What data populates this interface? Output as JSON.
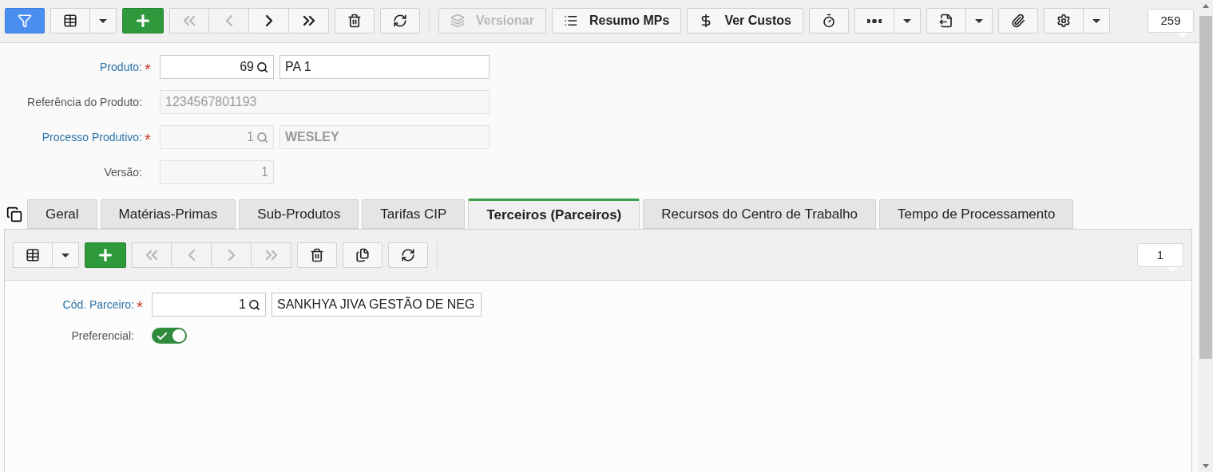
{
  "toolbar": {
    "items": [
      {
        "kind": "filter",
        "disabled": false
      },
      {
        "kind": "grid-menu",
        "disabled": false
      },
      {
        "kind": "add",
        "disabled": false
      },
      {
        "kind": "first",
        "disabled": true
      },
      {
        "kind": "prev",
        "disabled": true
      },
      {
        "kind": "next",
        "disabled": false
      },
      {
        "kind": "last",
        "disabled": false
      },
      {
        "kind": "delete",
        "disabled": false
      },
      {
        "kind": "refresh",
        "disabled": false
      },
      {
        "kind": "separator"
      },
      {
        "kind": "versions",
        "label": "Versionar",
        "disabled": true
      },
      {
        "kind": "list",
        "label": "Resumo MPs",
        "disabled": false
      },
      {
        "kind": "money",
        "label": "Ver Custos",
        "disabled": false
      },
      {
        "kind": "timer",
        "disabled": false
      },
      {
        "kind": "more-menu",
        "disabled": false
      },
      {
        "kind": "export-menu",
        "disabled": false
      },
      {
        "kind": "attach",
        "disabled": false
      },
      {
        "kind": "settings-menu",
        "disabled": false
      }
    ],
    "record_count": "259"
  },
  "form": [
    {
      "label": "Produto:",
      "required_mark": "*",
      "code": "69",
      "lookup": true,
      "description": "PA 1",
      "disabled": false
    },
    {
      "label": "Referência do Produto:",
      "value": "1234567801193",
      "disabled": true
    },
    {
      "label": "Processo Produtivo:",
      "required_mark": "*",
      "code": "1",
      "lookup": true,
      "description": "WESLEY",
      "disabled": true
    },
    {
      "label": "Versão:",
      "code": "1",
      "lookup": false,
      "disabled": true
    }
  ],
  "tabs": [
    {
      "label": "Geral",
      "selected": false
    },
    {
      "label": "Matérias-Primas",
      "selected": false
    },
    {
      "label": "Sub-Produtos",
      "selected": false
    },
    {
      "label": "Tarifas CIP",
      "selected": false
    },
    {
      "label": "Terceiros (Parceiros)",
      "selected": true
    },
    {
      "label": "Recursos do Centro de Trabalho",
      "selected": false
    },
    {
      "label": "Tempo de Processamento",
      "selected": false
    }
  ],
  "sub_toolbar": {
    "items": [
      {
        "kind": "grid-menu",
        "disabled": false
      },
      {
        "kind": "add",
        "disabled": false
      },
      {
        "kind": "first",
        "disabled": true
      },
      {
        "kind": "prev",
        "disabled": true
      },
      {
        "kind": "next",
        "disabled": true
      },
      {
        "kind": "last",
        "disabled": true
      },
      {
        "kind": "delete",
        "disabled": false
      },
      {
        "kind": "duplicate",
        "disabled": false
      },
      {
        "kind": "refresh",
        "disabled": false
      },
      {
        "kind": "separator"
      }
    ],
    "record_count": "1"
  },
  "sub_form": {
    "partner": {
      "label": "Cód. Parceiro:",
      "required_mark": "*",
      "code": "1",
      "description": "SANKHYA JIVA GESTÃO DE NEG"
    },
    "preferred": {
      "label": "Preferencial:",
      "on": true
    }
  }
}
